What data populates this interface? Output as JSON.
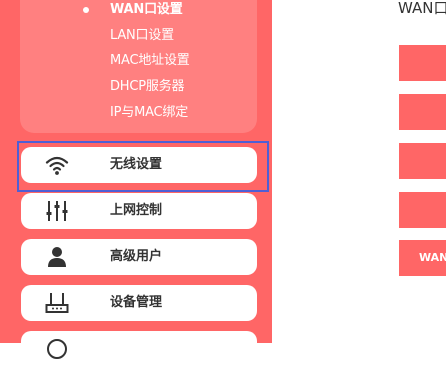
{
  "sidebar": {
    "submenu": [
      {
        "label": "WAN口设置",
        "active": true
      },
      {
        "label": "LAN口设置"
      },
      {
        "label": "MAC地址设置"
      },
      {
        "label": "DHCP服务器"
      },
      {
        "label": "IP与MAC绑定"
      }
    ],
    "menu": [
      {
        "label": "无线设置",
        "icon": "wifi-icon"
      },
      {
        "label": "上网控制",
        "icon": "sliders-icon"
      },
      {
        "label": "高级用户",
        "icon": "user-icon"
      },
      {
        "label": "设备管理",
        "icon": "router-icon"
      },
      {
        "label": "",
        "icon": "partial-icon"
      }
    ]
  },
  "main": {
    "title": "WAN口",
    "buttons": [
      {
        "label": ""
      },
      {
        "label": ""
      },
      {
        "label": ""
      },
      {
        "label": ""
      },
      {
        "label": "WAN"
      }
    ]
  },
  "colors": {
    "sidebar_bg": "#ff6666",
    "submenu_bg": "#ff8080",
    "focus_outline": "#4f5fd5",
    "accent": "#ff6666"
  }
}
